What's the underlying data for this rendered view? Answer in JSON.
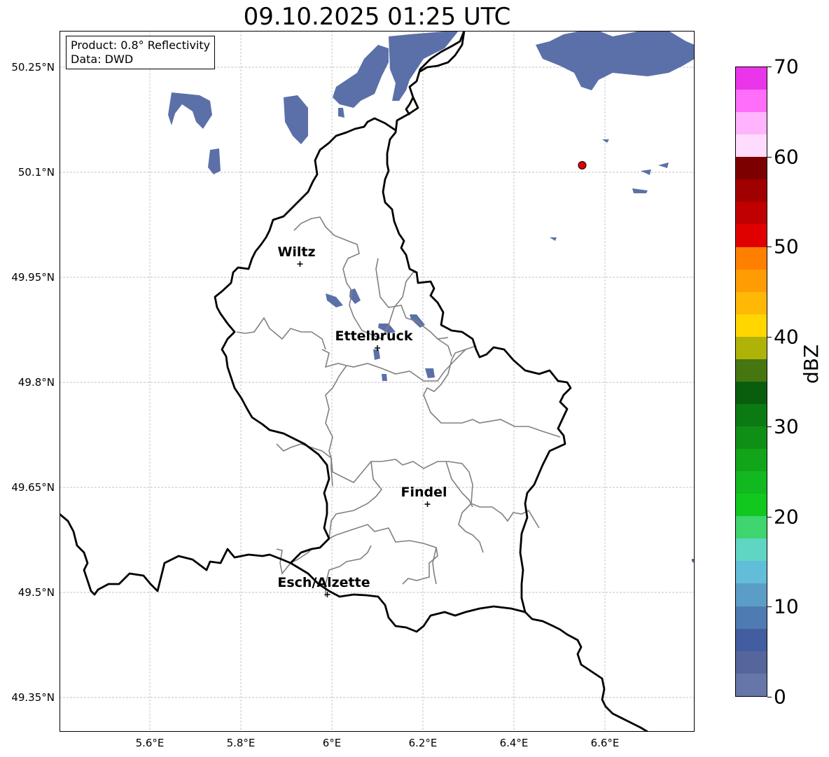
{
  "title": "09.10.2025 01:25 UTC",
  "info": {
    "product": "Product: 0.8° Reflectivity",
    "data": "Data: DWD"
  },
  "lat_ticks": [
    {
      "label": "50.25°N",
      "lat": 50.25
    },
    {
      "label": "50.1°N",
      "lat": 50.1
    },
    {
      "label": "49.95°N",
      "lat": 49.95
    },
    {
      "label": "49.8°N",
      "lat": 49.8
    },
    {
      "label": "49.65°N",
      "lat": 49.65
    },
    {
      "label": "49.5°N",
      "lat": 49.5
    },
    {
      "label": "49.35°N",
      "lat": 49.35
    }
  ],
  "lon_ticks": [
    {
      "label": "5.6°E",
      "lon": 5.6
    },
    {
      "label": "5.8°E",
      "lon": 5.8
    },
    {
      "label": "6°E",
      "lon": 6.0
    },
    {
      "label": "6.2°E",
      "lon": 6.2
    },
    {
      "label": "6.4°E",
      "lon": 6.4
    },
    {
      "label": "6.6°E",
      "lon": 6.6
    }
  ],
  "cities": [
    {
      "name": "Wiltz",
      "lon": 5.93,
      "lat": 49.969
    },
    {
      "name": "Ettelbruck",
      "lon": 6.1,
      "lat": 49.849
    },
    {
      "name": "Findel",
      "lon": 6.21,
      "lat": 49.626
    },
    {
      "name": "Esch/Alzette",
      "lon": 5.99,
      "lat": 49.497
    }
  ],
  "radar_site": {
    "lon": 6.55,
    "lat": 50.11,
    "color": "#e00000"
  },
  "colorbar": {
    "label": "dBZ",
    "ticks": [
      "0",
      "10",
      "20",
      "30",
      "40",
      "50",
      "60",
      "70"
    ],
    "min": 0,
    "max": 70,
    "colors": [
      "#6676a8",
      "#56669c",
      "#435da1",
      "#4f7bb3",
      "#5a9ec8",
      "#62bdd9",
      "#5fd6c4",
      "#3fd56f",
      "#12c81f",
      "#12b820",
      "#12a51a",
      "#0f8f15",
      "#0c7a12",
      "#085e0d",
      "#457610",
      "#b0b307",
      "#ffd600",
      "#ffb806",
      "#ff9c03",
      "#ff8000",
      "#e00000",
      "#c00000",
      "#a00000",
      "#7c0000",
      "#ffdcfd",
      "#ffb4fc",
      "#ff6efa",
      "#ea35ea"
    ]
  }
}
